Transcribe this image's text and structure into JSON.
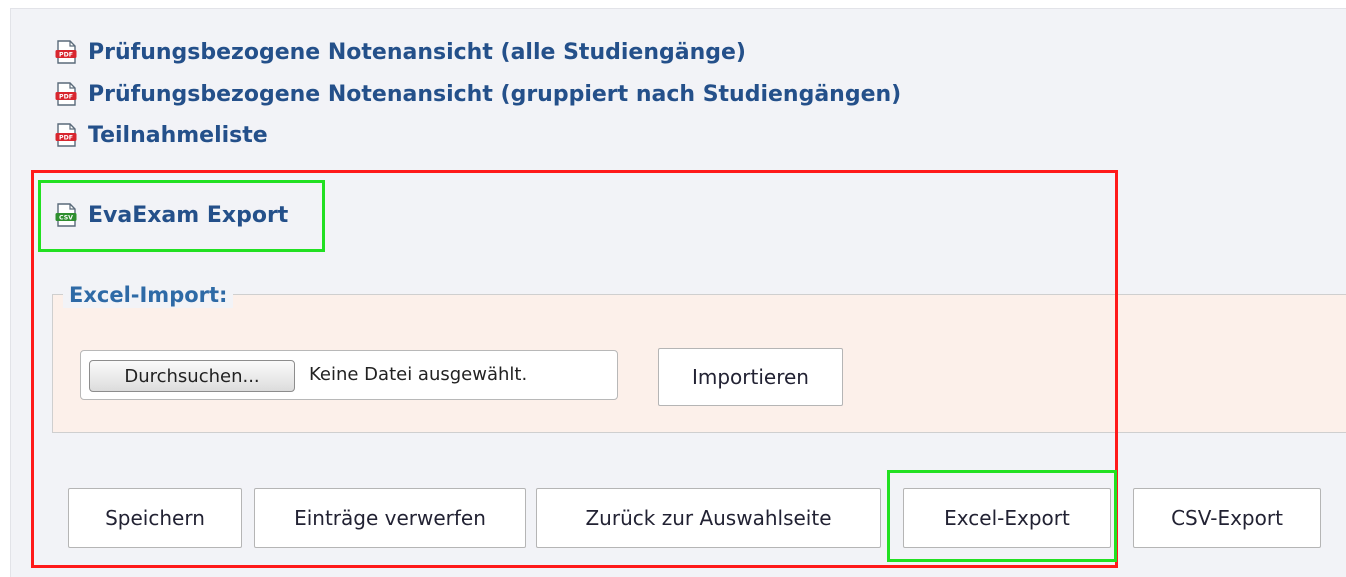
{
  "links": [
    {
      "label": "Prüfungsbezogene Notenansicht (alle Studiengänge)",
      "icon": "pdf-file-icon",
      "icon_text": "PDF"
    },
    {
      "label": "Prüfungsbezogene Notenansicht (gruppiert nach Studiengängen)",
      "icon": "pdf-file-icon",
      "icon_text": "PDF"
    },
    {
      "label": "Teilnahmeliste",
      "icon": "pdf-file-icon",
      "icon_text": "PDF"
    },
    {
      "label": "EvaExam Export",
      "icon": "csv-file-icon",
      "icon_text": "CSV"
    }
  ],
  "excel_import": {
    "legend": "Excel-Import:",
    "browse_label": "Durchsuchen...",
    "no_file_label": "Keine Datei ausgewählt.",
    "import_label": "Importieren"
  },
  "actions": {
    "save_label": "Speichern",
    "discard_label": "Einträge verwerfen",
    "back_label": "Zurück zur Auswahlseite",
    "excel_export_label": "Excel-Export",
    "csv_export_label": "CSV-Export"
  },
  "colors": {
    "link": "#24508a",
    "legend": "#2e6aa6",
    "highlight_red": "#ff1a1a",
    "highlight_green": "#22e022",
    "fieldset_bg": "#fcf0ea"
  }
}
